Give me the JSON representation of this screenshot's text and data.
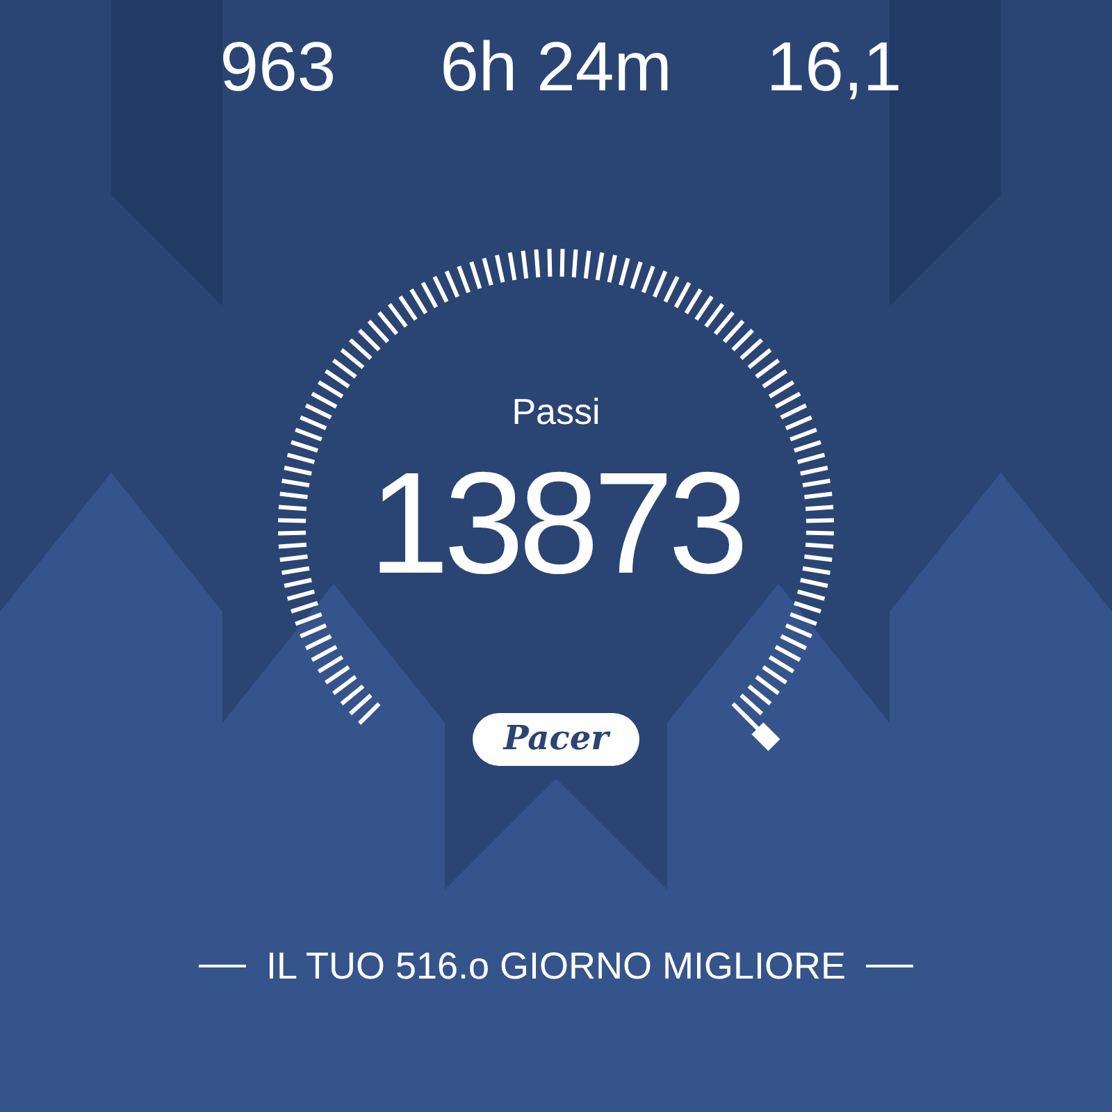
{
  "stats": [
    {
      "value": "963"
    },
    {
      "value": "6h 24m"
    },
    {
      "value": "16,1"
    }
  ],
  "gauge": {
    "label": "Passi",
    "value": "13873",
    "logo": "Pacer"
  },
  "best_day": "IL TUO 516.o GIORNO MIGLIORE"
}
